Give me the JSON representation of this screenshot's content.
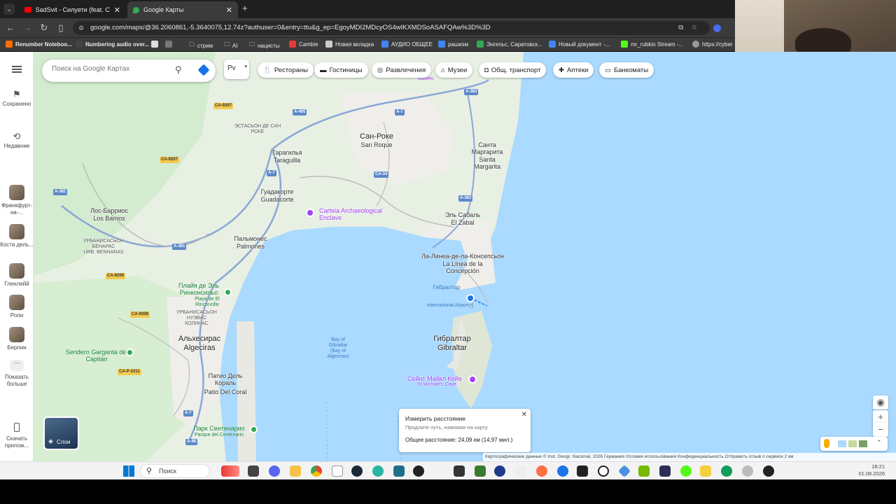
{
  "browser": {
    "tabs": [
      {
        "title": "SadSvit - Силуети (feat. СТРУКТ",
        "icon": "youtube-icon"
      },
      {
        "title": "Google Карты",
        "icon": "google-maps-icon"
      }
    ],
    "url": "google.com/maps/@36.2060861,-5.3640075,12.74z?authuser=0&entry=ttu&g_ep=EgoyMDI2MDcyOS4wIKXMDSoASAFQAw%3D%3D",
    "bookmarks": [
      "Renumber Noteboo...",
      "Numbering audio over...",
      "стрим",
      "AI",
      "нацисты",
      "Cambie",
      "Новая вкладка",
      "АУДИО ОБЩЕЕ",
      "рашизм",
      "Энгельс, Саратовск...",
      "Новый документ -...",
      "mr_rubkio Stream -...",
      "https://cyber"
    ]
  },
  "leftnav": {
    "items": [
      {
        "label": "Сохранено",
        "icon": "bookmark-icon"
      },
      {
        "label": "Недавние",
        "icon": "history-icon"
      },
      {
        "label": "Франкфурт-на-...",
        "icon": "place-thumb"
      },
      {
        "label": "Коста дель...",
        "icon": "place-thumb"
      },
      {
        "label": "Гленлейй",
        "icon": "place-thumb"
      },
      {
        "label": "Роли",
        "icon": "place-thumb"
      },
      {
        "label": "Берлин",
        "icon": "place-thumb"
      },
      {
        "label": "Показать больше",
        "icon": "more-icon"
      },
      {
        "label": "Скачать прилож...",
        "icon": "phone-icon"
      }
    ]
  },
  "search": {
    "placeholder": "Поиск на Google Картах"
  },
  "layer_dropdown": "Рv",
  "chips": [
    {
      "label": "Рестораны",
      "icon": "restaurant-icon"
    },
    {
      "label": "Гостиницы",
      "icon": "hotel-icon"
    },
    {
      "label": "Развлечения",
      "icon": "camera-icon"
    },
    {
      "label": "Музеи",
      "icon": "museum-icon"
    },
    {
      "label": "Общ. транспорт",
      "icon": "transit-icon"
    },
    {
      "label": "Аптеки",
      "icon": "pharmacy-icon"
    },
    {
      "label": "Банкоматы",
      "icon": "atm-icon"
    }
  ],
  "map": {
    "labels": {
      "san_roque_ru": "Сан-Роке",
      "san_roque": "San Roque",
      "santa_margarita_ru": "Санта Маргарита",
      "santa_margarita": "Santa Margarita",
      "taraguilla_ru": "Тарагилья",
      "taraguilla": "Taraguilla",
      "estacion_ru": "ЭСТАСЬОН ДЕ САН РОКЕ",
      "guadacorte_ru": "Гуадакорте",
      "guadacorte": "Guadacorte",
      "los_barrios_ru": "Лос-Барриос",
      "los_barrios": "Los Barrios",
      "benaras_ru": "УРБАНИСАСЬОН БЕНАРАС",
      "benaras": "URB. BENHARAS",
      "palmones_ru": "Пальмонес",
      "palmones": "Palmones",
      "el_zabal_ru": "Эль Сабаль",
      "el_zabal": "El Zabal",
      "la_linea_ru": "Ла-Линеа-де-ла-Консепсьон",
      "la_linea": "La Línea de la Concepción",
      "gibraltar_airport_ru": "Гибралтар",
      "gibraltar_airport": "International Airport",
      "gibraltar_ru": "Гибралтар",
      "gibraltar": "Gibraltar",
      "algeciras_ru": "Альхесирас",
      "algeciras": "Algeciras",
      "playa_ru": "Плайя де Эль Ринконсильо",
      "playa": "Playa de El Rinconcillo",
      "colinas_ru": "УРБАНИСАСЬОН НУЭВАС КОЛИНАС",
      "patio_ru": "Патио Дель Кораль",
      "patio": "Patio Del Coral",
      "parque_ru": "Парк Сентенарио",
      "parque": "Parque del Centenario",
      "bay": "Bay of Gibraltar (Bay of Algeciras)",
      "carteia_poi": "Carteia Archaeological Enclave",
      "st_michael_ru": "Сейнт Майкл Кейв",
      "st_michael": "St Michael's Cave",
      "sendero": "Sendero Garganta del Capitán",
      "casino": "Казино"
    },
    "roads": [
      "CA-9207",
      "A-405",
      "A-7",
      "A-383",
      "CA-9207",
      "A-7",
      "CA-34",
      "A-381",
      "A-383",
      "A-381",
      "CA-9209",
      "CA-9208",
      "CA-P-2311",
      "A-7",
      "A-48"
    ]
  },
  "measure": {
    "title": "Измерить расстояние",
    "hint": "Продлите путь, нажимая на карту",
    "total": "Общее расстояние: 24,09 км (14,97 мил.)"
  },
  "layers_button": "Слои",
  "footer": "Картографические данные © Inst. Geogr. Nacional, 2026   Германия   Условия использования   Конфиденциальность   Отправить отзыв о сервисе   2 км",
  "taskbar": {
    "search": "Поиск",
    "time": "18:21",
    "date": "01.08.2026"
  }
}
